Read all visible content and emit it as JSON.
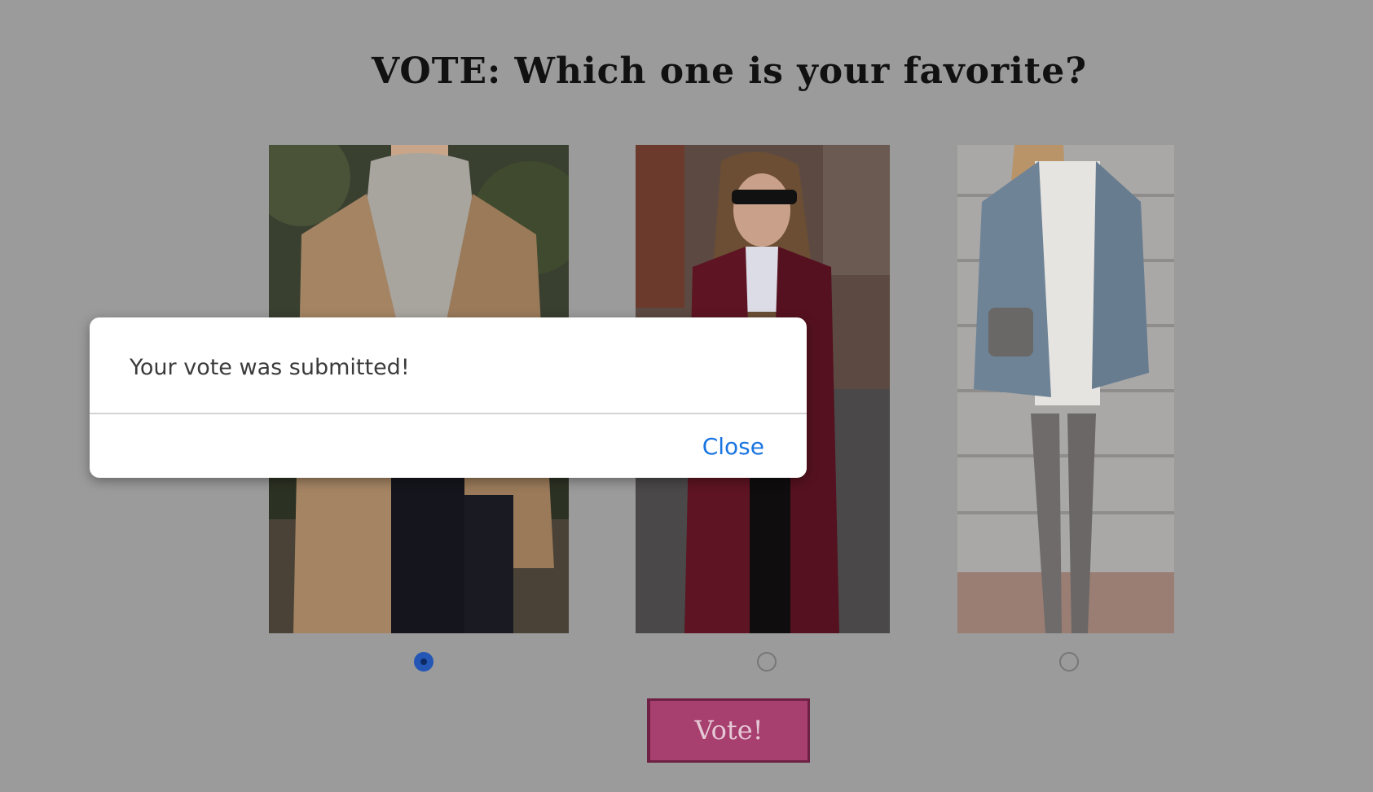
{
  "page": {
    "title": "VOTE: Which one is your favorite?"
  },
  "options": [
    {
      "selected": true
    },
    {
      "selected": false
    },
    {
      "selected": false
    }
  ],
  "vote_button": {
    "label": "Vote!"
  },
  "modal": {
    "message": "Your vote was submitted!",
    "close_label": "Close"
  },
  "colors": {
    "background": "#9b9b9b",
    "vote_button": "#a73f6f",
    "radio_selected": "#2457b5",
    "link": "#1a75e0"
  }
}
